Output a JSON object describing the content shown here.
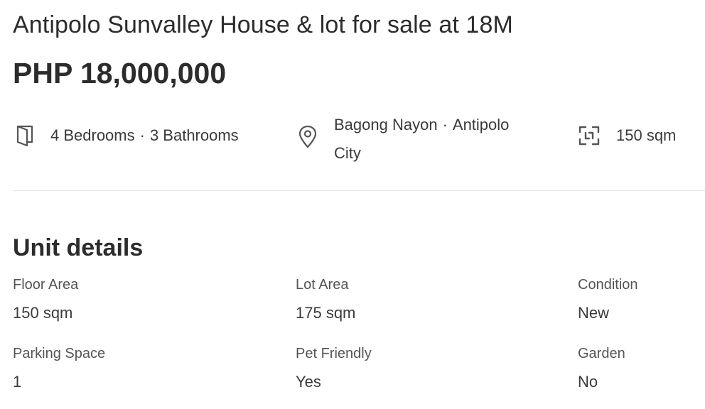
{
  "listing": {
    "title": "Antipolo Sunvalley House & lot for sale at 18M",
    "price": "PHP 18,000,000"
  },
  "facts": {
    "bedrooms": "4 Bedrooms",
    "separator": "·",
    "bathrooms": "3 Bathrooms",
    "location_area": "Bagong Nayon",
    "location_city": "Antipolo City",
    "floor_area": "150 sqm",
    "icons": {
      "rooms": "door-icon",
      "location": "map-pin-icon",
      "area": "area-frame-icon"
    }
  },
  "unit_details": {
    "heading": "Unit details",
    "items": [
      {
        "label": "Floor Area",
        "value": "150 sqm"
      },
      {
        "label": "Lot Area",
        "value": "175 sqm"
      },
      {
        "label": "Condition",
        "value": "New"
      },
      {
        "label": "Parking Space",
        "value": "1"
      },
      {
        "label": "Pet Friendly",
        "value": "Yes"
      },
      {
        "label": "Garden",
        "value": "No"
      }
    ]
  }
}
